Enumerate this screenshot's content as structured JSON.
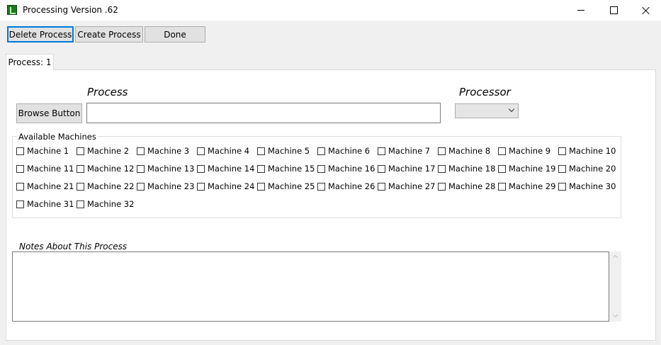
{
  "window": {
    "title": "Processing Version .62"
  },
  "toolbar": {
    "delete_label": "Delete Process",
    "create_label": "Create Process",
    "done_label": "Done"
  },
  "tab": {
    "label": "Process: 1"
  },
  "form": {
    "process_label": "Process",
    "processor_label": "Processor",
    "browse_label": "Browse Button",
    "process_value": "",
    "processor_value": ""
  },
  "machines": {
    "legend": "Available Machines",
    "items": [
      {
        "label": "Machine 1",
        "checked": false
      },
      {
        "label": "Machine 2",
        "checked": false
      },
      {
        "label": "Machine 3",
        "checked": false
      },
      {
        "label": "Machine 4",
        "checked": false
      },
      {
        "label": "Machine 5",
        "checked": false
      },
      {
        "label": "Machine 6",
        "checked": false
      },
      {
        "label": "Machine 7",
        "checked": false
      },
      {
        "label": "Machine 8",
        "checked": false
      },
      {
        "label": "Machine 9",
        "checked": false
      },
      {
        "label": "Machine 10",
        "checked": false
      },
      {
        "label": "Machine 11",
        "checked": false
      },
      {
        "label": "Machine 12",
        "checked": false
      },
      {
        "label": "Machine 13",
        "checked": false
      },
      {
        "label": "Machine 14",
        "checked": false
      },
      {
        "label": "Machine 15",
        "checked": false
      },
      {
        "label": "Machine 16",
        "checked": false
      },
      {
        "label": "Machine 17",
        "checked": false
      },
      {
        "label": "Machine 18",
        "checked": false
      },
      {
        "label": "Machine 19",
        "checked": false
      },
      {
        "label": "Machine 20",
        "checked": false
      },
      {
        "label": "Machine 21",
        "checked": false
      },
      {
        "label": "Machine 22",
        "checked": false
      },
      {
        "label": "Machine 23",
        "checked": false
      },
      {
        "label": "Machine 24",
        "checked": false
      },
      {
        "label": "Machine 25",
        "checked": false
      },
      {
        "label": "Machine 26",
        "checked": false
      },
      {
        "label": "Machine 27",
        "checked": false
      },
      {
        "label": "Machine 28",
        "checked": false
      },
      {
        "label": "Machine 29",
        "checked": false
      },
      {
        "label": "Machine 30",
        "checked": false
      },
      {
        "label": "Machine 31",
        "checked": false
      },
      {
        "label": "Machine 32",
        "checked": false
      }
    ]
  },
  "notes": {
    "label": "Notes About This Process",
    "value": ""
  },
  "colors": {
    "focus_border": "#0078d7",
    "window_bg": "#f0f0f0",
    "button_bg": "#e1e1e1"
  }
}
